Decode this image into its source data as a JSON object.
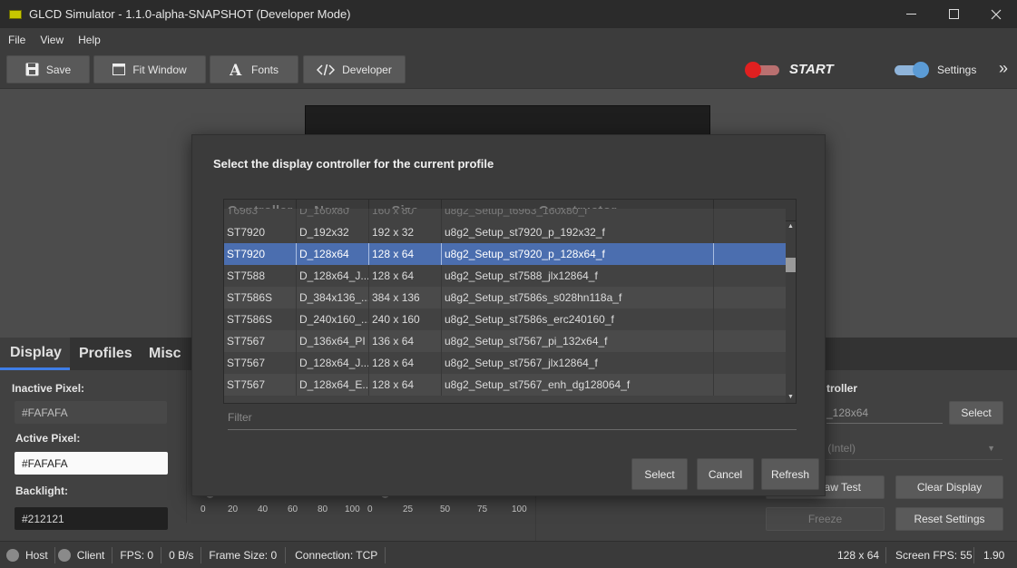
{
  "window": {
    "title": "GLCD Simulator - 1.1.0-alpha-SNAPSHOT (Developer Mode)",
    "minimize": "—",
    "maximize": "☐",
    "close": "✕"
  },
  "menu": [
    "File",
    "View",
    "Help"
  ],
  "toolbar": {
    "save": "Save",
    "fit_window": "Fit Window",
    "fonts": "Fonts",
    "developer": "Developer",
    "start": "START",
    "settings": "Settings",
    "expand": "»"
  },
  "tabs": [
    "Display",
    "Profiles",
    "Misc"
  ],
  "display_panel": {
    "inactive_label": "Inactive Pixel:",
    "inactive_value": "#FAFAFA",
    "active_label": "Active Pixel:",
    "active_value": "#FAFAFA",
    "backlight_label": "Backlight:",
    "backlight_value": "#212121"
  },
  "slider_scales": {
    "left": [
      "0",
      "20",
      "40",
      "60",
      "80",
      "100"
    ],
    "right": [
      "0",
      "25",
      "50",
      "75",
      "100"
    ]
  },
  "controller_panel": {
    "label": "troller",
    "value": "_128x64",
    "select": "Select",
    "device": ") (Intel)",
    "draw_test": "aw Test",
    "clear_display": "Clear Display",
    "freeze": "Freeze",
    "reset_settings": "Reset Settings"
  },
  "status": {
    "host": "Host",
    "client": "Client",
    "fps": "FPS: 0",
    "rate": "0 B/s",
    "frame_size": "Frame Size: 0",
    "connection": "Connection: TCP",
    "resolution": "128 x 64",
    "screen_fps": "Screen FPS: 55",
    "version": "1.90"
  },
  "dialog": {
    "heading": "Select the display controller for the current profile",
    "columns": [
      "Controller",
      "Name",
      "Size",
      "Constructor"
    ],
    "partial_row": {
      "controller": "T6963",
      "name": "D_160x80",
      "size": "160 x 80",
      "constructor": "u8g2_Setup_t6963_160x80_f"
    },
    "rows": [
      {
        "controller": "ST7920",
        "name": "D_192x32",
        "size": "192 x 32",
        "constructor": "u8g2_Setup_st7920_p_192x32_f"
      },
      {
        "controller": "ST7920",
        "name": "D_128x64",
        "size": "128 x 64",
        "constructor": "u8g2_Setup_st7920_p_128x64_f"
      },
      {
        "controller": "ST7588",
        "name": "D_128x64_J...",
        "size": "128 x 64",
        "constructor": "u8g2_Setup_st7588_jlx12864_f"
      },
      {
        "controller": "ST7586S",
        "name": "D_384x136_...",
        "size": "384 x 136",
        "constructor": "u8g2_Setup_st7586s_s028hn118a_f"
      },
      {
        "controller": "ST7586S",
        "name": "D_240x160_...",
        "size": "240 x 160",
        "constructor": "u8g2_Setup_st7586s_erc240160_f"
      },
      {
        "controller": "ST7567",
        "name": "D_136x64_PI",
        "size": "136 x 64",
        "constructor": "u8g2_Setup_st7567_pi_132x64_f"
      },
      {
        "controller": "ST7567",
        "name": "D_128x64_J...",
        "size": "128 x 64",
        "constructor": "u8g2_Setup_st7567_jlx12864_f"
      },
      {
        "controller": "ST7567",
        "name": "D_128x64_E...",
        "size": "128 x 64",
        "constructor": "u8g2_Setup_st7567_enh_dg128064_f"
      }
    ],
    "selected_index": 1,
    "filter_placeholder": "Filter",
    "buttons": {
      "select": "Select",
      "cancel": "Cancel",
      "refresh": "Refresh"
    }
  },
  "colors": {
    "accent": "#3f7ee8",
    "selected_row": "#4b6eaf",
    "start_toggle": "#e02020",
    "settings_toggle": "#5b9bd5"
  }
}
